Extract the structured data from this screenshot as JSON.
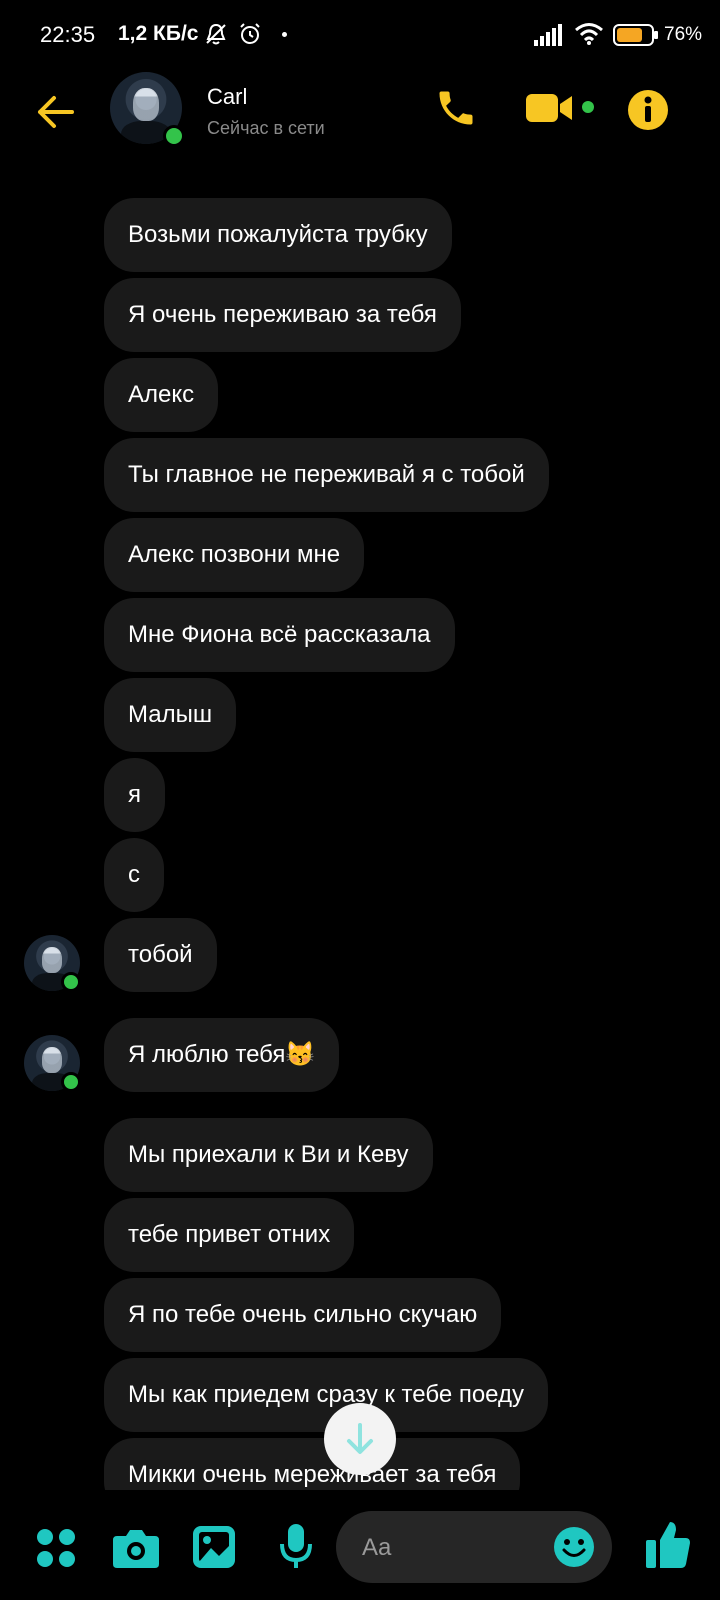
{
  "status_bar": {
    "time": "22:35",
    "speed": "1,2 КБ/с",
    "battery_percent": "76%",
    "battery_level": 0.76,
    "icons": [
      "bell-off-icon",
      "alarm-icon",
      "signal-icon",
      "wifi-icon",
      "battery-icon"
    ]
  },
  "header": {
    "contact_name": "Carl",
    "contact_status": "Сейчас в сети",
    "icons": [
      "back-arrow-icon",
      "phone-icon",
      "video-call-icon",
      "info-icon"
    ]
  },
  "messages": [
    {
      "text": "Возьми пожалуйста трубку"
    },
    {
      "text": "Я очень переживаю за тебя"
    },
    {
      "text": "Алекс"
    },
    {
      "text": "Ты главное не переживай я с тобой"
    },
    {
      "text": "Алекс позвони мне"
    },
    {
      "text": "Мне Фиона всё рассказала"
    },
    {
      "text": "Малыш"
    },
    {
      "text": "я"
    },
    {
      "text": "с"
    },
    {
      "text": "тобой",
      "avatar": true
    },
    {
      "text": "Я люблю тебя😽",
      "avatar": true
    },
    {
      "text": "Мы приехали к Ви и Кеву"
    },
    {
      "text": "тебе привет отних"
    },
    {
      "text": "Я по тебе очень сильно  скучаю"
    },
    {
      "text": "Мы как приедем сразу к тебе поеду"
    },
    {
      "text": "Микки очень мереживает за тебя"
    }
  ],
  "composer": {
    "placeholder": "Aa",
    "icons": [
      "apps-grid-icon",
      "camera-icon",
      "gallery-icon",
      "microphone-icon",
      "emoji-icon",
      "thumbs-up-icon"
    ]
  },
  "colors": {
    "background": "#000000",
    "bubble": "#1a1a1a",
    "header_accent": "#f7c623",
    "composer_accent": "#1fc7c1",
    "online": "#33c34a"
  }
}
